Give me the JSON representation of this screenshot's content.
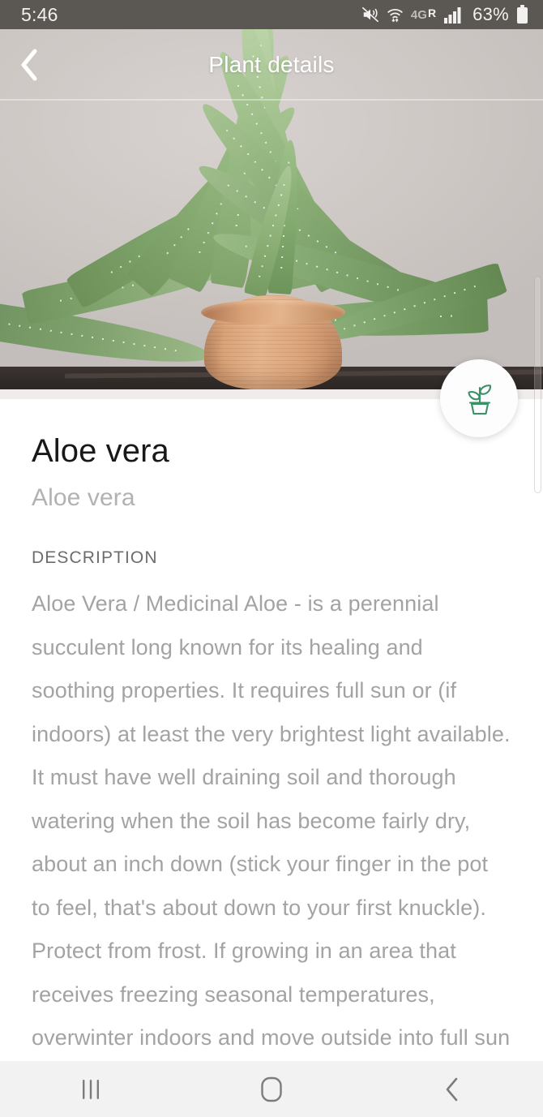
{
  "status_bar": {
    "time": "5:46",
    "battery_percent": "63%",
    "icons": [
      "mute-vibrate-icon",
      "wifi-icon",
      "network-4g-roaming-icon",
      "signal-bars-icon",
      "battery-icon"
    ],
    "network_label": "4G",
    "roaming_label": "R",
    "background_color": "#5b5854",
    "text_color": "#f2f1ef"
  },
  "header": {
    "title": "Plant details",
    "back_icon": "chevron-left-icon",
    "title_color": "#ffffff"
  },
  "hero": {
    "alt": "Aloe vera plant in a terracotta pot on a dark shelf against a light gray wall",
    "wall_color": "#cdc7c4",
    "pot_color": "#d79e73",
    "leaf_color": "#8fae78"
  },
  "fab": {
    "icon": "potted-plant-icon",
    "icon_color": "#3a9067",
    "background_color": "#fdfdfd"
  },
  "plant": {
    "name": "Aloe vera",
    "scientific_name": "Aloe vera",
    "description_label": "DESCRIPTION",
    "description": "Aloe Vera / Medicinal Aloe - is a perennial succulent long known for its healing and soothing properties. It requires full sun or (if indoors) at least the very brightest light available. It must have well draining soil and thorough watering when the soil has become fairly dry, about an inch down (stick your finger in the pot to feel, that's about down to your first knuckle). Protect from frost. If growing in an area that receives freezing seasonal temperatures, overwinter indoors and move outside into full sun as soon as"
  },
  "nav_bar": {
    "recents_icon": "recents-icon",
    "home_icon": "home-icon",
    "back_icon": "back-chevron-icon",
    "background_color": "#f2f2f2",
    "icon_color": "#7c7c7c"
  },
  "scrollbar": {
    "visible": true
  }
}
